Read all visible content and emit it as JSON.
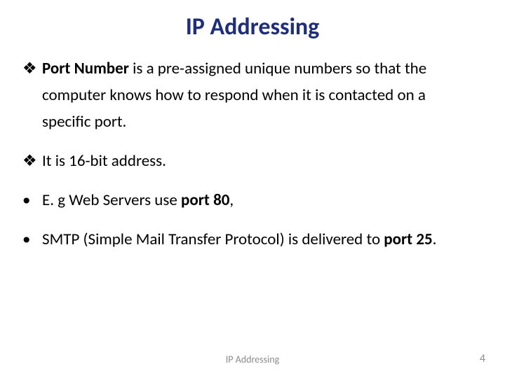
{
  "title": "IP Addressing",
  "bullets": {
    "b1_lead": "Port Number",
    "b1_rest": " is a pre-assigned unique numbers so that the computer knows how to respond when it is contacted on a specific port.",
    "b2": "It is 16-bit address.",
    "b3_a": "E. g  Web Servers use ",
    "b3_b": "port  80",
    "b3_c": ",",
    "b4_a": "SMTP (Simple Mail Transfer Protocol) is delivered to ",
    "b4_b": "port 25",
    "b4_c": "."
  },
  "footer": {
    "center": "IP Addressing",
    "page": "4"
  }
}
